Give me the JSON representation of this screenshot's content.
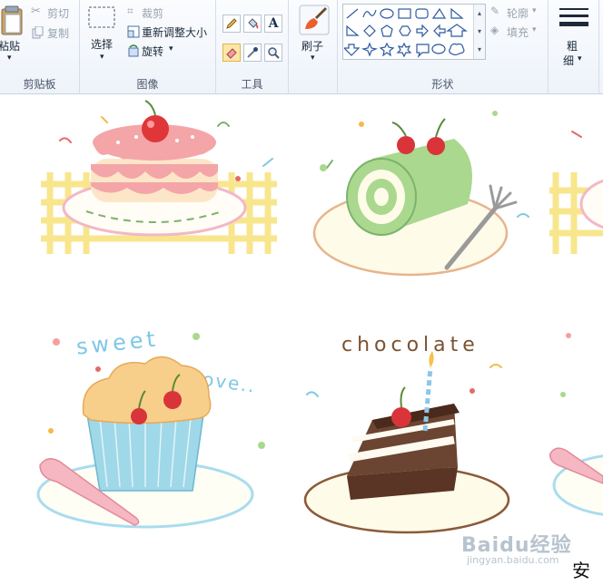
{
  "clipboard": {
    "paste_label": "粘贴",
    "cut_label": "剪切",
    "copy_label": "复制",
    "group_label": "剪贴板"
  },
  "image": {
    "select_label": "选择",
    "crop_label": "裁剪",
    "resize_label": "重新调整大小",
    "rotate_label": "旋转",
    "group_label": "图像"
  },
  "tools": {
    "text_label": "A",
    "group_label": "工具"
  },
  "brush": {
    "label": "刷子"
  },
  "shapes": {
    "outline_label": "轮廓",
    "fill_label": "填充",
    "group_label": "形状"
  },
  "size": {
    "label_line1": "粗",
    "label_line2": "细"
  },
  "canvas": {
    "text_sweet": "sweet",
    "text_love": "Love..",
    "text_chocolate": "chocolate"
  },
  "watermark": {
    "brand": "Baidu经验",
    "url": "jingyan.baidu.com",
    "corner_text": "安卓"
  },
  "colors": {
    "accent": "#fde7a6",
    "ribbon_border": "#c5d2e3",
    "frosting_pink": "#f4a5a8",
    "roll_green": "#a9d88e",
    "cup_blue": "#9fd8e8",
    "chocolate": "#6b4432"
  }
}
